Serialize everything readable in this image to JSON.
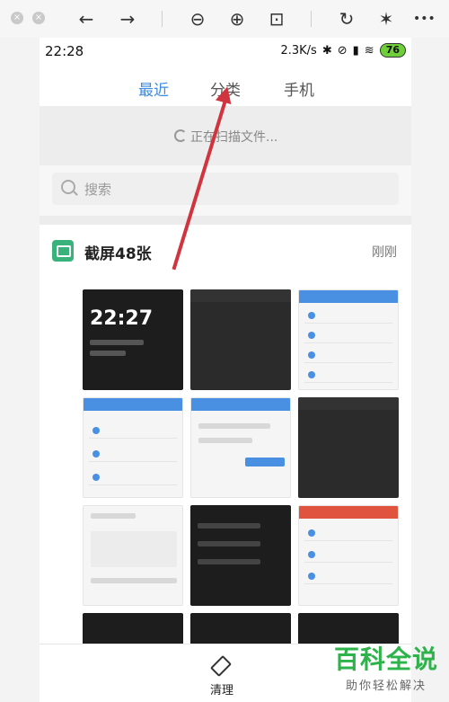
{
  "viewer_toolbar": {
    "close": "×",
    "minimize": "×",
    "back_icon": "arrow-left-icon",
    "forward_icon": "arrow-right-icon",
    "zoom_out_icon": "zoom-out-icon",
    "zoom_in_icon": "zoom-in-icon",
    "fit_icon": "fit-screen-icon",
    "rotate_icon": "rotate-icon",
    "magic_icon": "magic-wand-icon",
    "more_icon": "more-icon",
    "more_glyph": "•••"
  },
  "status_bar": {
    "time": "22:28",
    "speed": "2.3K/s",
    "battery": "76"
  },
  "tabs": [
    {
      "label": "最近",
      "active": true
    },
    {
      "label": "分类",
      "active": false
    },
    {
      "label": "手机",
      "active": false
    }
  ],
  "scan": {
    "text": "正在扫描文件..."
  },
  "search": {
    "placeholder": "搜索"
  },
  "group": {
    "title": "截屏48张",
    "time": "刚刚"
  },
  "thumbnails": [
    {
      "style": "lockscreen",
      "clock": "22:27"
    },
    {
      "style": "dark-editor"
    },
    {
      "style": "file-list"
    },
    {
      "style": "wps-dialog"
    },
    {
      "style": "save-dialog"
    },
    {
      "style": "dark-editor"
    },
    {
      "style": "new-doc"
    },
    {
      "style": "dark-menu"
    },
    {
      "style": "wps-office"
    },
    {
      "style": "dark"
    },
    {
      "style": "dark"
    },
    {
      "style": "dark"
    }
  ],
  "bottom": {
    "clean_label": "清理"
  },
  "watermark": {
    "main": "百科全说",
    "sub": "助你轻松解决"
  },
  "colors": {
    "accent": "#3b8de0",
    "arrow": "#d0343e",
    "group_icon": "#3ab27c",
    "battery": "#6fcf3a"
  }
}
